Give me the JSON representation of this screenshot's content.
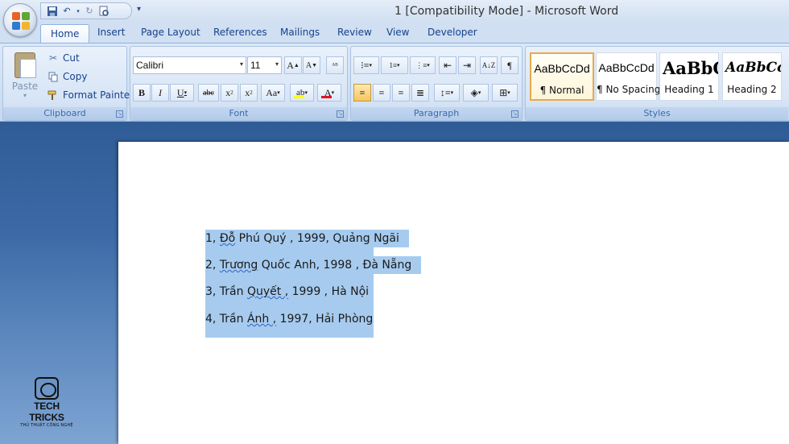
{
  "window": {
    "title": "1 [Compatibility Mode] - Microsoft Word"
  },
  "quick_access": {
    "icons": [
      "save-icon",
      "undo-icon",
      "redo-icon",
      "print-preview-icon",
      "customize-qat-icon"
    ]
  },
  "tabs": [
    {
      "label": "Home",
      "active": true
    },
    {
      "label": "Insert"
    },
    {
      "label": "Page Layout"
    },
    {
      "label": "References"
    },
    {
      "label": "Mailings"
    },
    {
      "label": "Review"
    },
    {
      "label": "View"
    },
    {
      "label": "Developer"
    }
  ],
  "ribbon": {
    "clipboard": {
      "label": "Clipboard",
      "paste": "Paste",
      "cut": "Cut",
      "copy": "Copy",
      "format_painter": "Format Painter"
    },
    "font": {
      "label": "Font",
      "font_name": "Calibri",
      "font_size": "11",
      "highlight_color": "#ffff00",
      "font_color": "#e0141e"
    },
    "paragraph": {
      "label": "Paragraph",
      "align_left_active": true
    },
    "styles": {
      "label": "Styles",
      "items": [
        {
          "sample": "AaBbCcDd",
          "name": "¶ Normal",
          "selected": true
        },
        {
          "sample": "AaBbCcDd",
          "name": "¶ No Spacing"
        },
        {
          "sample": "AaBbC(",
          "name": "Heading 1"
        },
        {
          "sample": "AaBbCc",
          "name": "Heading 2"
        }
      ]
    }
  },
  "document": {
    "lines": [
      {
        "a": "1, ",
        "b": "Đỗ",
        "c": " Phú Quý ,  1999,  Quảng Ngãi"
      },
      {
        "a": "2, ",
        "b": "Trương",
        "c": " Quốc Anh,  1998 ,  Đà Nẵng"
      },
      {
        "a": "3, Trần ",
        "b": "Quyết ,",
        "c": " 1999  , Hà Nội"
      },
      {
        "a": "4, Trần ",
        "b": "Ánh ,",
        "c": " 1997, Hải Phòng"
      }
    ]
  },
  "watermark": {
    "title": "TECH TRICKS",
    "subtitle": "THỦ THUẬT CÔNG NGHỆ"
  }
}
